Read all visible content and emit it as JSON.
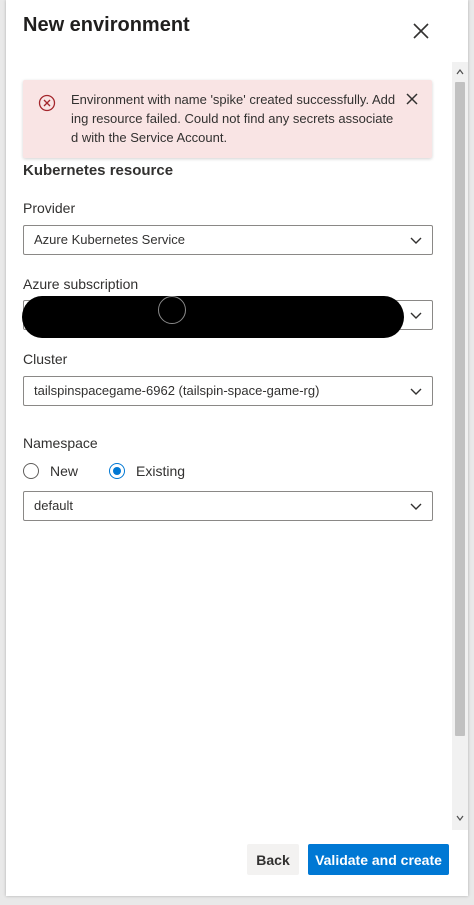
{
  "panel": {
    "title": "New environment"
  },
  "alert": {
    "message": "Environment with name 'spike' created successfully. Adding resource failed. Could not find any secrets associated with the Service Account."
  },
  "form": {
    "section_title": "Kubernetes resource",
    "provider": {
      "label": "Provider",
      "value": "Azure Kubernetes Service"
    },
    "subscription": {
      "label": "Azure subscription",
      "value": ""
    },
    "cluster": {
      "label": "Cluster",
      "value": "tailspinspacegame-6962 (tailspin-space-game-rg)"
    },
    "namespace": {
      "label": "Namespace",
      "option_new": "New",
      "option_existing": "Existing",
      "selected": "Existing",
      "value": "default"
    }
  },
  "footer": {
    "back_label": "Back",
    "primary_label": "Validate and create"
  },
  "colors": {
    "accent": "#0078d4",
    "alert_bg": "#f9e4e4",
    "error_icon": "#a4262c"
  }
}
